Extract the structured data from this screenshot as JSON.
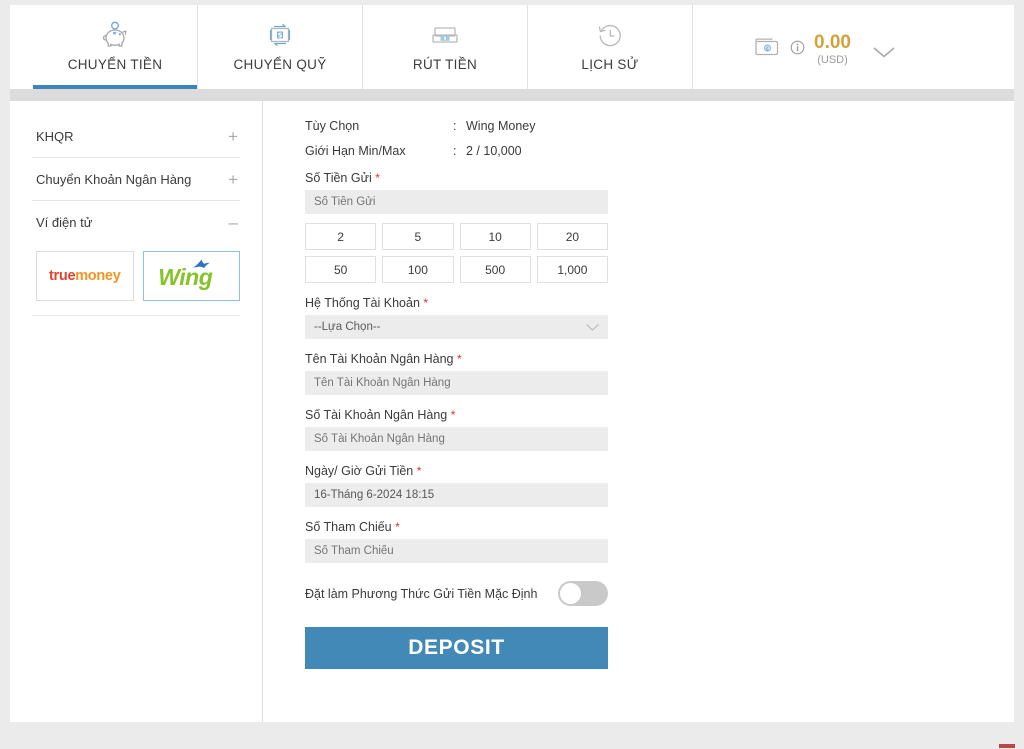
{
  "header": {
    "tabs": [
      {
        "label": "CHUYỂN TIỀN",
        "icon": "piggy-bank-icon",
        "active": true
      },
      {
        "label": "CHUYỂN QUỸ",
        "icon": "transfer-funds-icon",
        "active": false
      },
      {
        "label": "RÚT TIỀN",
        "icon": "atm-withdraw-icon",
        "active": false
      },
      {
        "label": "LỊCH SỬ",
        "icon": "history-clock-icon",
        "active": false
      }
    ],
    "balance": {
      "amount": "0.00",
      "currency": "(USD)",
      "wallet_icon": "wallet-icon",
      "info_icon": "info-icon",
      "chevron_icon": "chevron-down-icon"
    }
  },
  "sidebar": {
    "groups": [
      {
        "label": "KHQR",
        "sign": "+",
        "expanded": false
      },
      {
        "label": "Chuyển Khoản Ngân Hàng",
        "sign": "+",
        "expanded": false
      },
      {
        "label": "Ví điện tử",
        "sign": "–",
        "expanded": true
      }
    ],
    "wallets": [
      {
        "name": "truemoney",
        "part1": "true",
        "part2": "money",
        "selected": false
      },
      {
        "name": "Wing",
        "text": "Wing",
        "selected": true
      }
    ]
  },
  "form": {
    "info": [
      {
        "key": "Tùy Chọn",
        "sep": ":",
        "value": "Wing Money"
      },
      {
        "key": "Giới Hạn Min/Max",
        "sep": ":",
        "value": "2 / 10,000"
      }
    ],
    "amount_label": "Số Tiền Gửi",
    "amount_placeholder": "Số Tiền Gửi",
    "amount_value": "",
    "quick_amounts": [
      "2",
      "5",
      "10",
      "20",
      "50",
      "100",
      "500",
      "1,000"
    ],
    "account_system_label": "Hệ Thống Tài Khoản",
    "account_system_value": "--Lựa Chọn--",
    "bank_name_label": "Tên Tài Khoản Ngân Hàng",
    "bank_name_placeholder": "Tên Tài Khoản Ngân Hàng",
    "bank_name_value": "",
    "bank_number_label": "Số Tài Khoản Ngân Hàng",
    "bank_number_placeholder": "Số Tài Khoản Ngân Hàng",
    "bank_number_value": "",
    "datetime_label": "Ngày/ Giờ Gửi Tiền",
    "datetime_value": "16-Tháng 6-2024 18:15",
    "reference_label": "Số Tham Chiếu",
    "reference_placeholder": "Số Tham Chiếu",
    "reference_value": "",
    "default_toggle_label": "Đặt làm Phương Thức Gửi Tiền Mặc Định",
    "default_toggle_state": "off",
    "submit_label": "DEPOSIT",
    "required_mark": "*"
  },
  "colors": {
    "accent_blue": "#3a85b9",
    "button_blue": "#4389b8",
    "required_red": "#e0322a",
    "balance_gold": "#d2a33c",
    "field_gray": "#ececec",
    "page_bg": "#ebebeb"
  }
}
